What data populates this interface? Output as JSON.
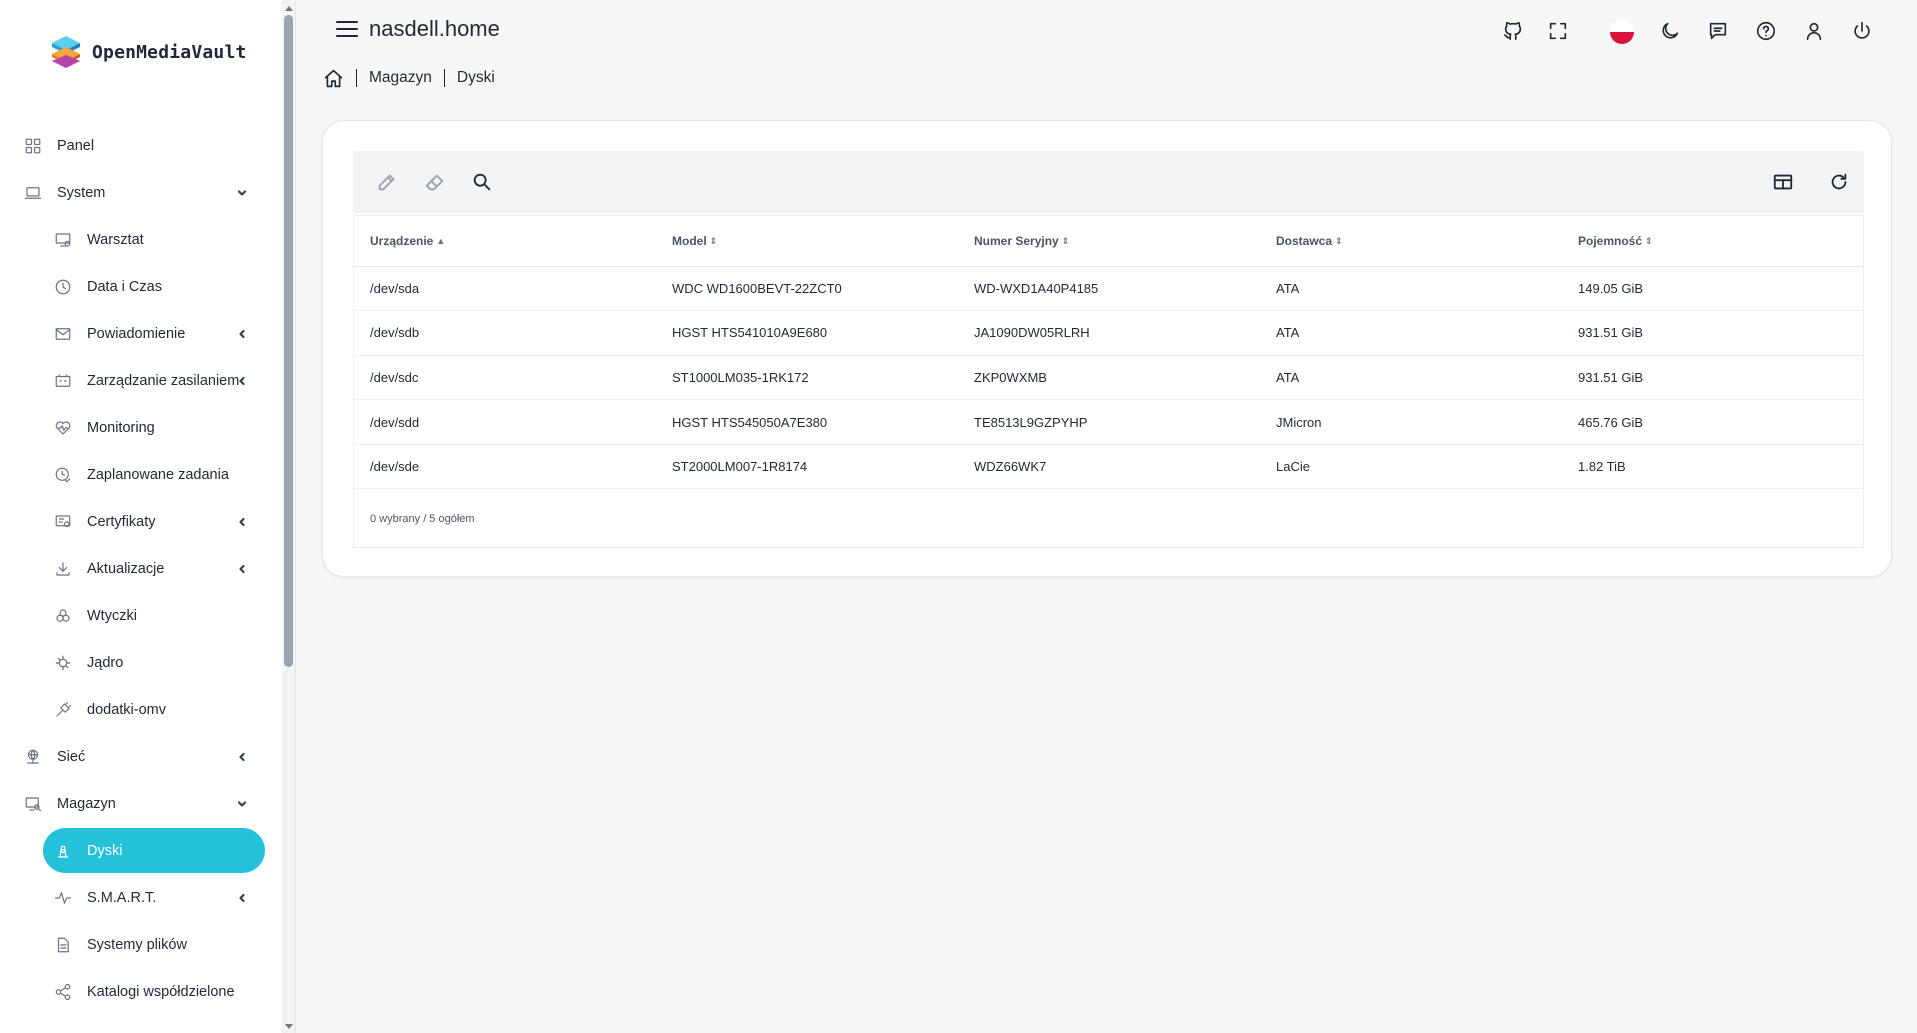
{
  "app": {
    "brand": "OpenMediaVault",
    "hostname": "nasdell.home"
  },
  "header": {
    "icons": [
      "github-icon",
      "fullscreen-icon",
      "language-flag",
      "dark-mode-icon",
      "feedback-icon",
      "help-icon",
      "user-icon",
      "power-icon"
    ]
  },
  "breadcrumb": {
    "items": [
      "Magazyn",
      "Dyski"
    ]
  },
  "sidebar": {
    "items": [
      {
        "label": "Panel",
        "icon": "dashboard-icon",
        "level": 0
      },
      {
        "label": "System",
        "icon": "laptop-icon",
        "level": 0,
        "chevron": "down"
      },
      {
        "label": "Warsztat",
        "icon": "monitor-settings-icon",
        "level": 1
      },
      {
        "label": "Data i Czas",
        "icon": "clock-icon",
        "level": 1
      },
      {
        "label": "Powiadomienie",
        "icon": "mail-icon",
        "level": 1,
        "chevron": "left"
      },
      {
        "label": "Zarządzanie zasilaniem",
        "icon": "battery-icon",
        "level": 1,
        "chevron": "left"
      },
      {
        "label": "Monitoring",
        "icon": "heart-pulse-icon",
        "level": 1
      },
      {
        "label": "Zaplanowane zadania",
        "icon": "clock-check-icon",
        "level": 1
      },
      {
        "label": "Certyfikaty",
        "icon": "certificate-icon",
        "level": 1,
        "chevron": "left"
      },
      {
        "label": "Aktualizacje",
        "icon": "download-icon",
        "level": 1,
        "chevron": "left"
      },
      {
        "label": "Wtyczki",
        "icon": "puzzle-icon",
        "level": 1
      },
      {
        "label": "Jądro",
        "icon": "kernel-icon",
        "level": 1
      },
      {
        "label": "dodatki-omv",
        "icon": "plug-icon",
        "level": 1
      },
      {
        "label": "Sieć",
        "icon": "network-icon",
        "level": 0,
        "chevron": "left"
      },
      {
        "label": "Magazyn",
        "icon": "storage-icon",
        "level": 0,
        "chevron": "down"
      },
      {
        "label": "Dyski",
        "icon": "disk-icon",
        "level": 1,
        "active": true
      },
      {
        "label": "S.M.A.R.T.",
        "icon": "pulse-icon",
        "level": 1,
        "chevron": "left"
      },
      {
        "label": "Systemy plików",
        "icon": "file-icon",
        "level": 1
      },
      {
        "label": "Katalogi współdzielone",
        "icon": "share-icon",
        "level": 1
      }
    ]
  },
  "toolbar": {
    "icons": [
      "edit-icon",
      "eraser-icon",
      "search-icon",
      "columns-icon",
      "refresh-icon"
    ]
  },
  "table": {
    "headers": [
      {
        "label": "Urządzenie",
        "sort": "▲"
      },
      {
        "label": "Model",
        "sort": "⇕"
      },
      {
        "label": "Numer Seryjny",
        "sort": "⇕"
      },
      {
        "label": "Dostawca",
        "sort": "⇕"
      },
      {
        "label": "Pojemność",
        "sort": "⇕"
      }
    ],
    "rows": [
      [
        "/dev/sda",
        "WDC WD1600BEVT-22ZCT0",
        "WD-WXD1A40P4185",
        "ATA",
        "149.05 GiB"
      ],
      [
        "/dev/sdb",
        "HGST HTS541010A9E680",
        "JA1090DW05RLRH",
        "ATA",
        "931.51 GiB"
      ],
      [
        "/dev/sdc",
        "ST1000LM035-1RK172",
        "ZKP0WXMB",
        "ATA",
        "931.51 GiB"
      ],
      [
        "/dev/sdd",
        "HGST HTS545050A7E380",
        "TE8513L9GZPYHP",
        "JMicron",
        "465.76 GiB"
      ],
      [
        "/dev/sde",
        "ST2000LM007-1R8174",
        "WDZ66WK7",
        "LaCie",
        "1.82 TiB"
      ]
    ],
    "footer": "0 wybrany / 5 ogółem"
  },
  "colors": {
    "accent": "#25c1db",
    "flag_top": "#ffffff",
    "flag_bottom": "#dc143c"
  }
}
